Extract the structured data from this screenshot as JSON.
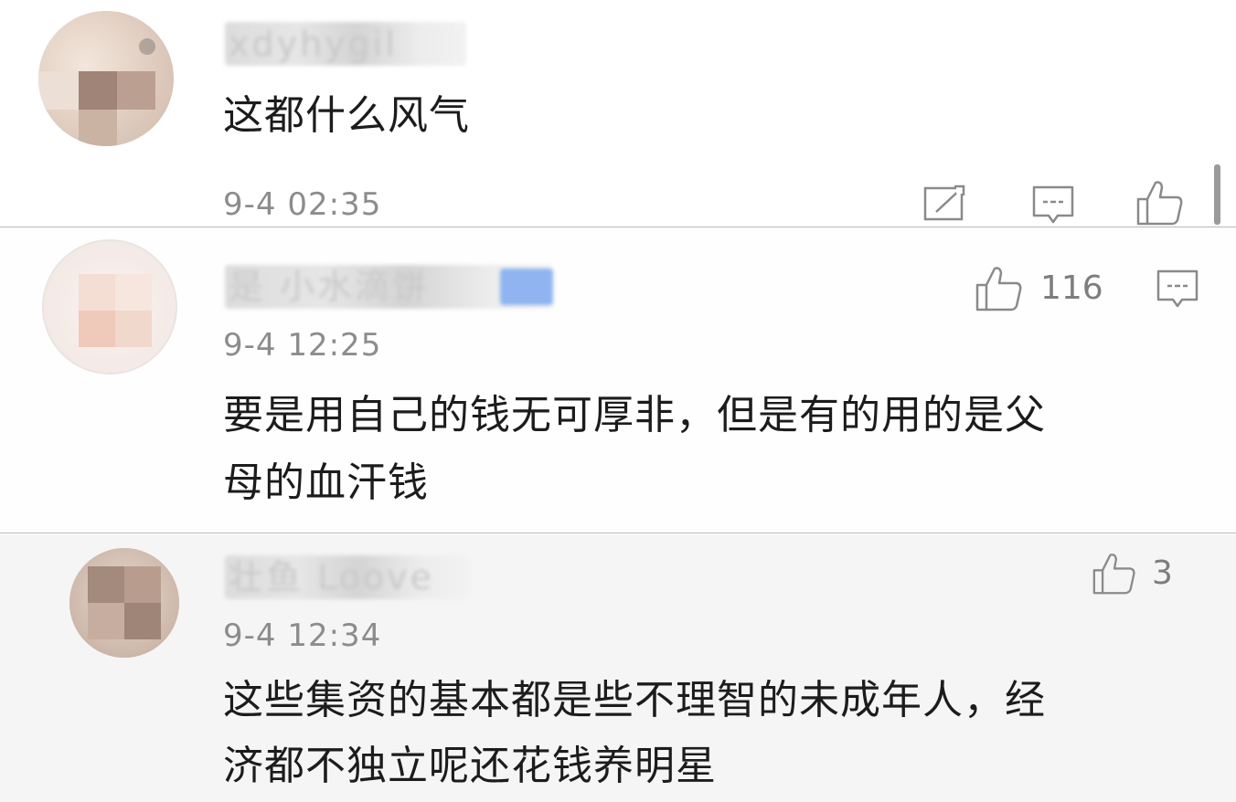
{
  "comments": [
    {
      "username": "xdyhygil",
      "text": "这都什么风气",
      "time": "9-4 02:35",
      "actions": [
        "share-icon",
        "reply-icon",
        "like-icon"
      ]
    },
    {
      "username": "是 小水滴饼",
      "text_line1": "要是用自己的钱无可厚非，但是有的用的是父",
      "text_line2": "母的血汗钱",
      "time": "9-4 12:25",
      "likes": "116",
      "actions": [
        "like-icon",
        "reply-icon"
      ]
    },
    {
      "username": "壮鱼 Loove",
      "text_line1": "这些集资的基本都是些不理智的未成年人，经",
      "text_line2": "济都不独立呢还花钱养明星",
      "time": "9-4 12:34",
      "likes": "3",
      "actions": [
        "like-icon"
      ]
    }
  ],
  "colors": {
    "text": "#1c1c1c",
    "meta": "#8c8c8c",
    "divider": "#b9b9b9",
    "third_bg": "#f5f5f5"
  }
}
